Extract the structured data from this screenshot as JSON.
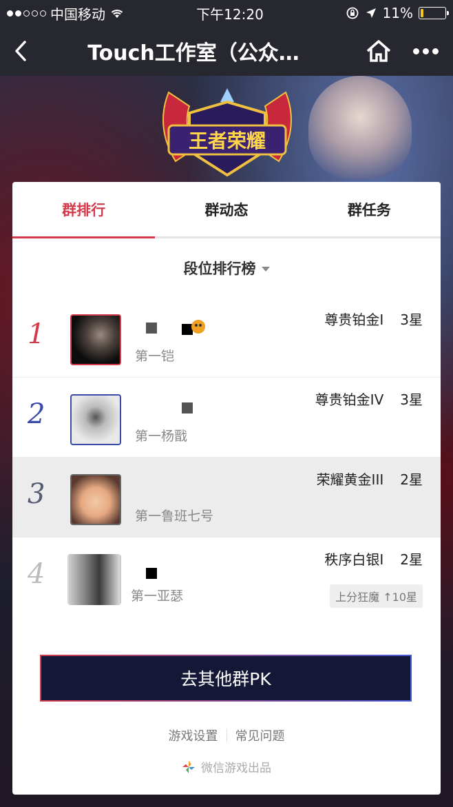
{
  "status_bar": {
    "carrier": "中国移动",
    "time": "下午12:20",
    "battery_percent": "11%",
    "battery_level": 0.11
  },
  "nav": {
    "title": "Touch工作室（公众…"
  },
  "banner": {
    "logo_text": "王者荣耀"
  },
  "tabs": [
    {
      "label": "群排行",
      "active": true
    },
    {
      "label": "群动态",
      "active": false
    },
    {
      "label": "群任务",
      "active": false
    }
  ],
  "ranking": {
    "selector_label": "段位排行榜",
    "rows": [
      {
        "rank": "1",
        "subtitle": "第一铠",
        "tier": "尊贵铂金I",
        "stars": "3星",
        "rank_color": "#d33a4b"
      },
      {
        "rank": "2",
        "subtitle": "第一杨戬",
        "tier": "尊贵铂金IV",
        "stars": "3星",
        "rank_color": "#3a4aa8"
      },
      {
        "rank": "3",
        "subtitle": "第一鲁班七号",
        "tier": "荣耀黄金III",
        "stars": "2星",
        "rank_color": "#555a6e"
      },
      {
        "rank": "4",
        "subtitle": "第一亚瑟",
        "tier": "秩序白银I",
        "stars": "2星",
        "tag": "上分狂魔 ↑10星",
        "rank_color": "#bbbbbb"
      }
    ]
  },
  "pk_button": "去其他群PK",
  "footer": {
    "links": [
      "游戏设置",
      "常见问题"
    ],
    "credit": "微信游戏出品"
  },
  "colors": {
    "accent": "#d33a4b",
    "button_bg": "#141735"
  }
}
